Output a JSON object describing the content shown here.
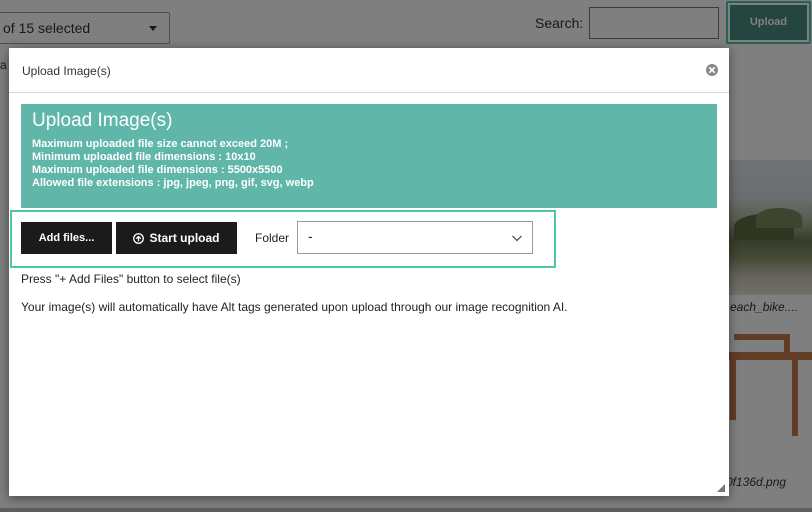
{
  "background": {
    "select_value": "of 15 selected",
    "search_label": "Search:",
    "upload_label": "Upload",
    "pattern_fragment": "a",
    "caption_beach": "each_bike....",
    "caption_chair": "0f136d.png"
  },
  "modal": {
    "title": "Upload Image(s)",
    "info": {
      "heading": "Upload Image(s)",
      "lines": [
        "Maximum uploaded file size cannot exceed 20M ;",
        "Minimum uploaded file dimensions : 10x10",
        "Maximum uploaded file dimensions : 5500x5500",
        "Allowed file extensions : jpg, jpeg, png, gif, svg, webp"
      ]
    },
    "add_files_label": "Add files...",
    "start_upload_label": "Start upload",
    "folder_label": "Folder",
    "folder_value": "-",
    "hint": "Press \"+ Add Files\" button to select file(s)",
    "alt_note": "Your image(s) will automatically have Alt tags generated upon upload through our image recognition AI."
  },
  "colors": {
    "accent_teal": "#5fb6a9",
    "frame_green": "#4fc7a5",
    "button_dark": "#1b1b1b",
    "upload_btn": "#4a8d80"
  },
  "icons": [
    "close-icon",
    "upload-circle-icon",
    "chevron-down-icon",
    "resize-handle-icon",
    "caret-down-icon"
  ]
}
